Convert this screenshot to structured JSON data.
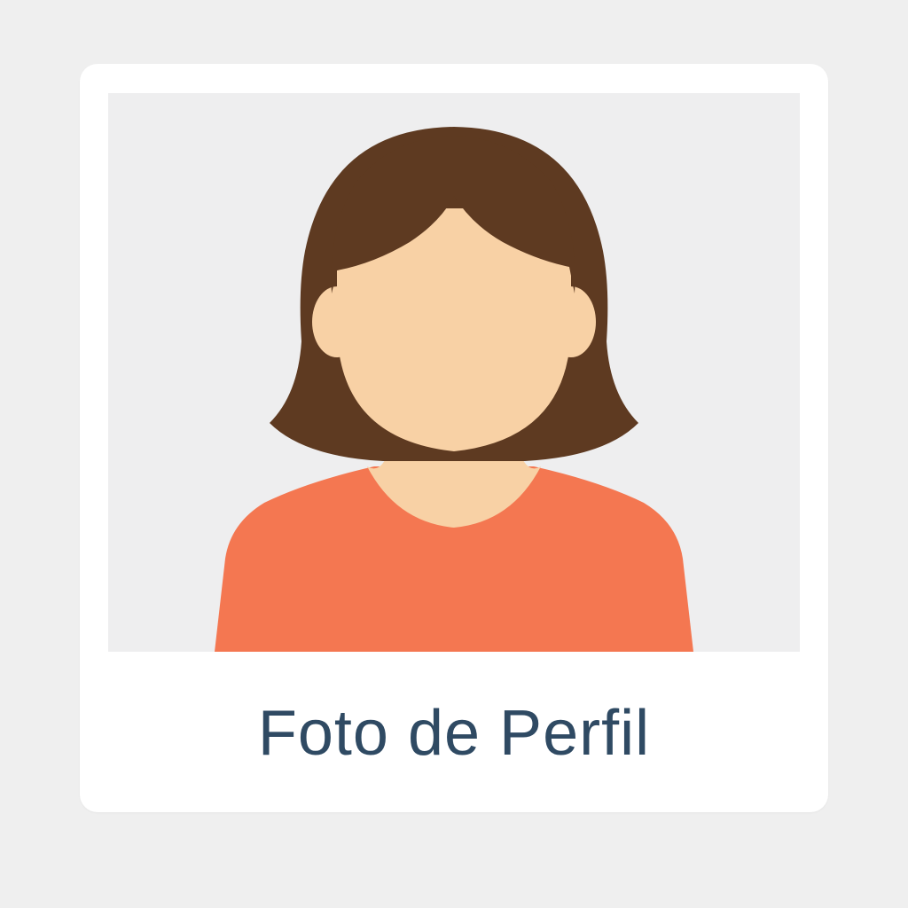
{
  "card": {
    "caption": "Foto de Perfil"
  },
  "avatar": {
    "icon": "person-avatar-icon",
    "colors": {
      "background": "#eeeeef",
      "hair": "#5e3a21",
      "skin": "#f8d1a5",
      "skin_shadow": "#e7b98d",
      "shirt": "#f47751"
    }
  },
  "colors": {
    "page_background": "#efefef",
    "card_background": "#ffffff",
    "caption_text": "#2f4a63"
  }
}
